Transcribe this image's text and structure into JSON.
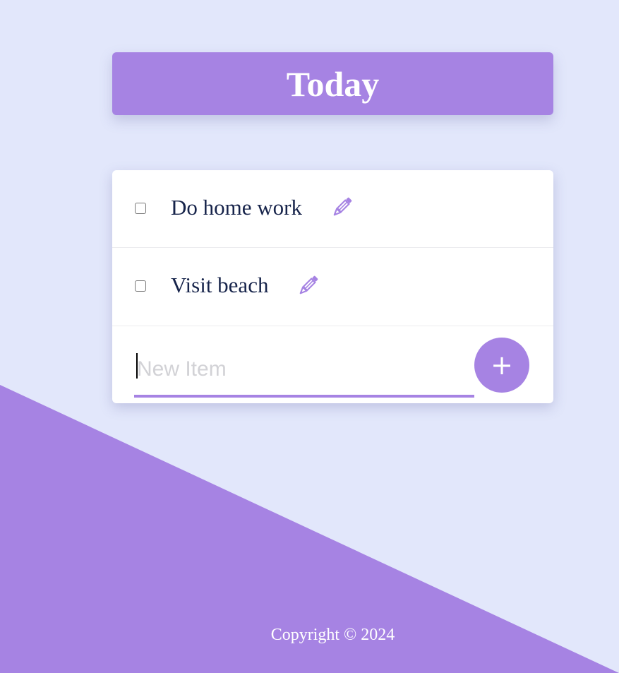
{
  "header": {
    "title": "Today"
  },
  "items": [
    {
      "label": "Do home work",
      "checked": false,
      "edit_icon": "pencil-icon"
    },
    {
      "label": "Visit beach",
      "checked": false,
      "edit_icon": "pencil-icon"
    }
  ],
  "new_item": {
    "placeholder": "New Item",
    "value": "",
    "add_label": "+"
  },
  "footer": {
    "text": "Copyright © 2024"
  },
  "colors": {
    "background": "#e2e7fb",
    "accent": "#a683e3",
    "card": "#ffffff",
    "item_text": "#16234a"
  }
}
